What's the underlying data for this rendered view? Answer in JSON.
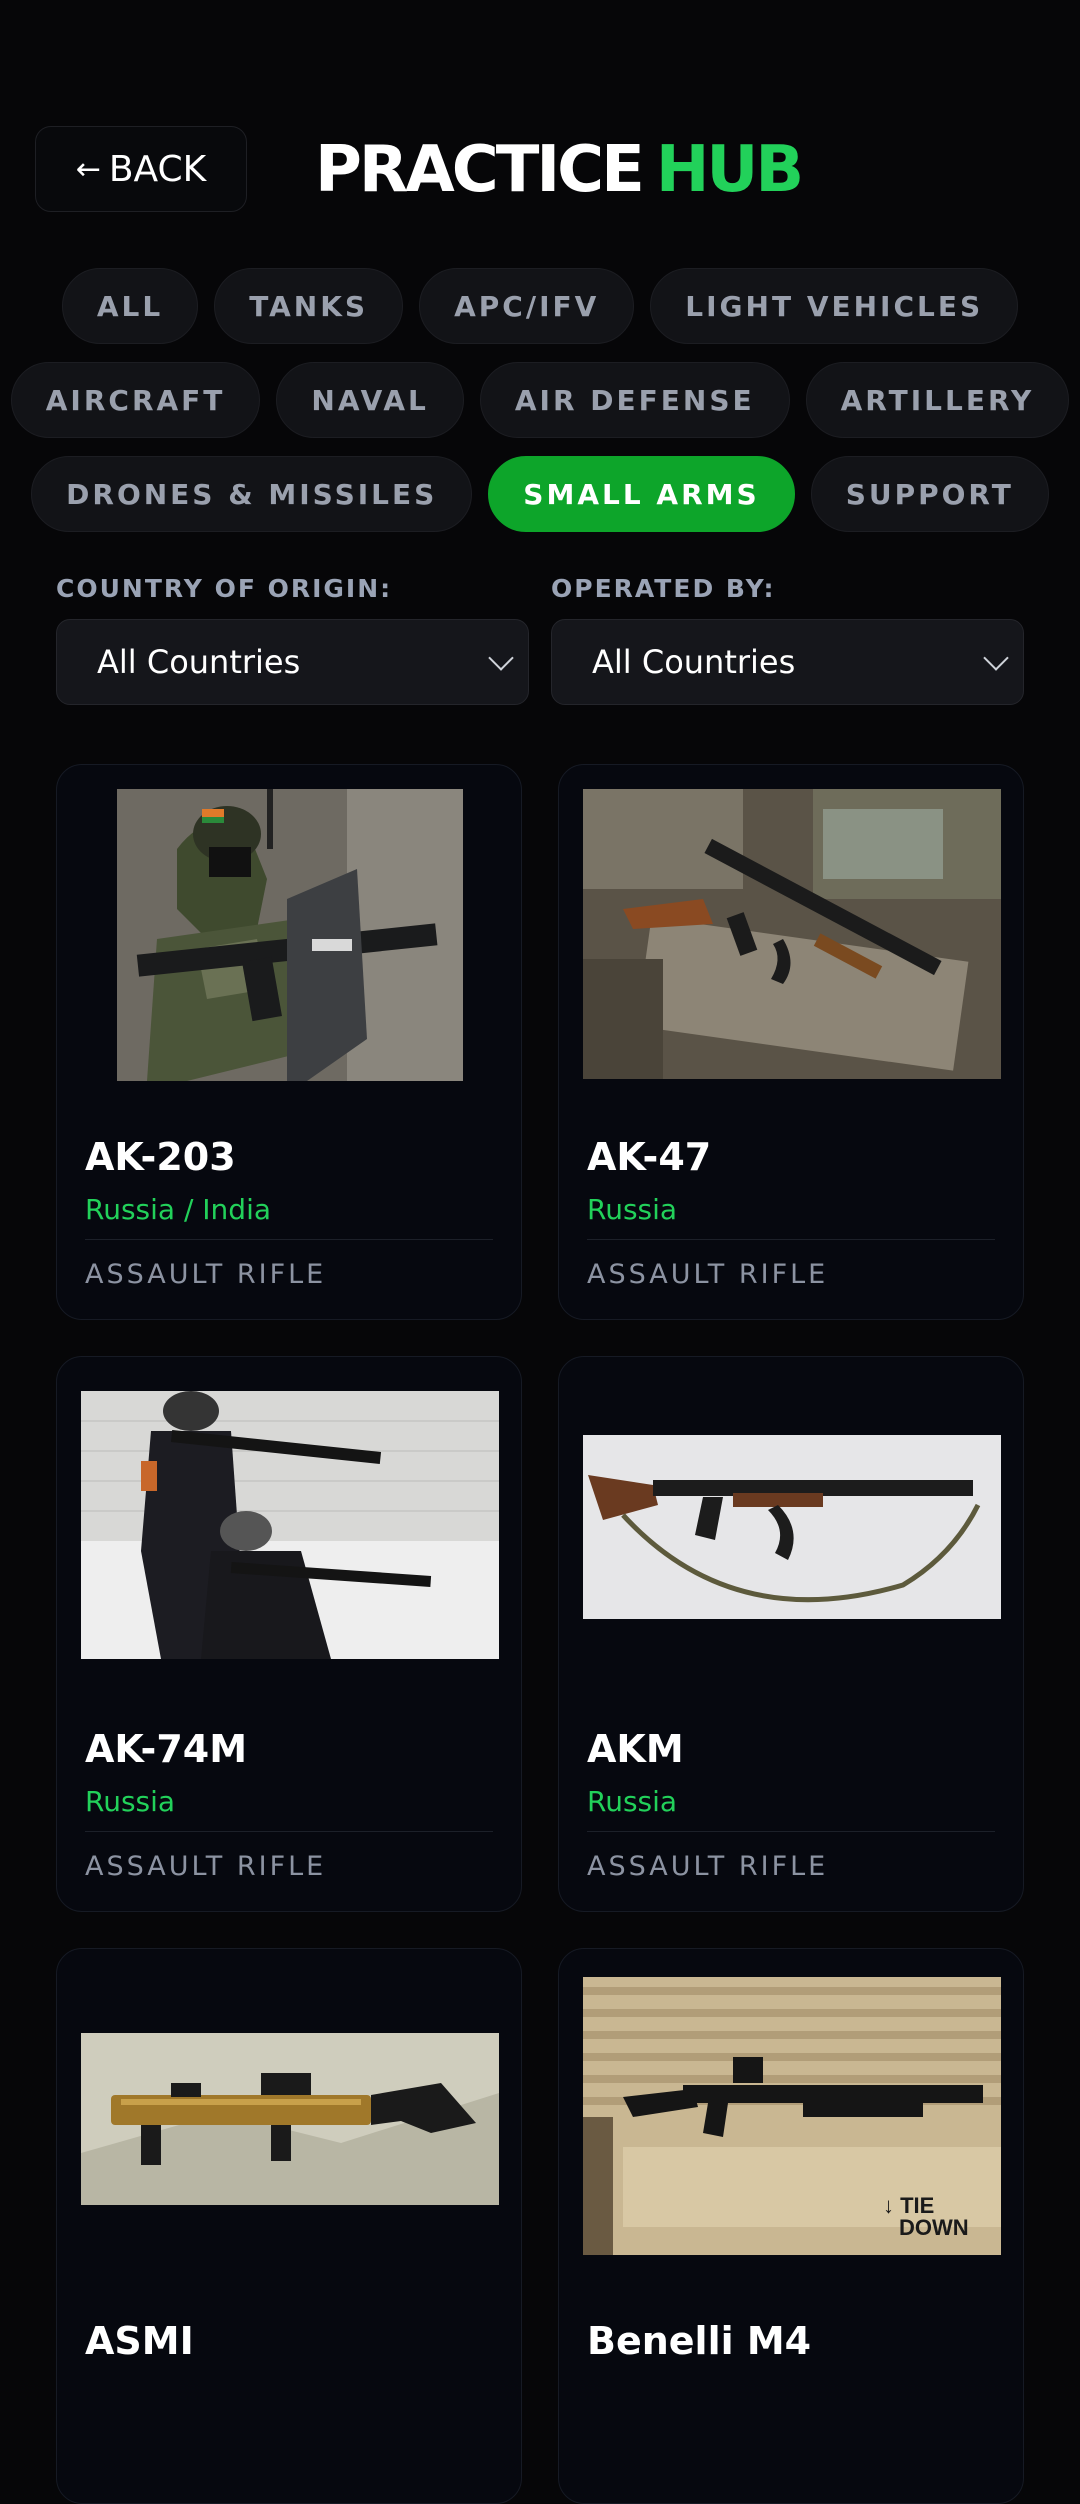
{
  "header": {
    "back_label": "BACK",
    "title_main": "PRACTICE",
    "title_accent": "HUB",
    "accent_color": "#22d15a"
  },
  "categories": {
    "row1": [
      "ALL",
      "TANKS",
      "APC/IFV",
      "LIGHT VEHICLES"
    ],
    "row2": [
      "AIRCRAFT",
      "NAVAL",
      "AIR DEFENSE",
      "ARTILLERY"
    ],
    "row3": [
      "DRONES & MISSILES",
      "SMALL ARMS",
      "SUPPORT"
    ],
    "active": "SMALL ARMS",
    "active_color": "#0da52a"
  },
  "filters": {
    "country_label": "COUNTRY OF ORIGIN:",
    "country_value": "All Countries",
    "operated_label": "OPERATED BY:",
    "operated_value": "All Countries"
  },
  "cards": [
    {
      "name": "AK-203",
      "origin": "Russia / India",
      "type": "ASSAULT RIFLE",
      "image": "soldier-with-rifle-and-shield-photo"
    },
    {
      "name": "AK-47",
      "origin": "Russia",
      "type": "ASSAULT RIFLE",
      "image": "rifle-on-logs-photo"
    },
    {
      "name": "AK-74M",
      "origin": "Russia",
      "type": "ASSAULT RIFLE",
      "image": "two-soldiers-aiming-photo"
    },
    {
      "name": "AKM",
      "origin": "Russia",
      "type": "ASSAULT RIFLE",
      "image": "rifle-on-white-cloth-photo"
    },
    {
      "name": "ASMI",
      "origin": "",
      "type": "",
      "image": "bullpup-rifle-on-rock-photo"
    },
    {
      "name": "Benelli M4",
      "origin": "",
      "type": "",
      "image": "shotgun-on-vehicle-photo"
    }
  ]
}
